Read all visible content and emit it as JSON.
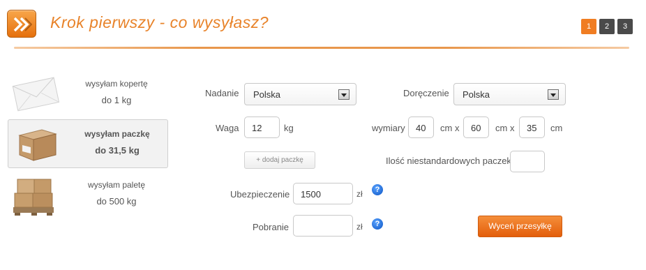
{
  "header": {
    "title": "Krok pierwszy - co wysyłasz?",
    "logo_icon": "double-chevron-right-icon",
    "steps": [
      "1",
      "2",
      "3"
    ],
    "active_step": "1"
  },
  "types": [
    {
      "name": "wysyłam kopertę",
      "weight": "do 1 kg",
      "icon": "envelope-icon"
    },
    {
      "name": "wysyłam paczkę",
      "weight": "do 31,5 kg",
      "icon": "box-icon"
    },
    {
      "name": "wysyłam paletę",
      "weight": "do 500 kg",
      "icon": "pallet-icon"
    }
  ],
  "form": {
    "nadanie_label": "Nadanie",
    "nadanie_value": "Polska",
    "doreczenie_label": "Doręczenie",
    "doreczenie_value": "Polska",
    "waga_label": "Waga",
    "waga_value": "12",
    "waga_unit": "kg",
    "wymiary_label": "wymiary",
    "dim1": "40",
    "dim2": "60",
    "dim3": "35",
    "unit_cmx": "cm x",
    "unit_cm": "cm",
    "add_package_label": "+ dodaj paczkę",
    "nonstandard_label": "Ilość niestandardowych paczek",
    "nonstandard_value": "",
    "ubezpieczenie_label": "Ubezpieczenie",
    "ubezpieczenie_value": "1500",
    "currency": "zł",
    "pobranie_label": "Pobranie",
    "pobranie_value": "",
    "help_glyph": "?",
    "submit_label": "Wyceń przesyłkę"
  },
  "colors": {
    "accent": "#e8832a",
    "button": "#f07d22",
    "step_inactive": "#4a4a4a",
    "help": "#0b54c4"
  }
}
